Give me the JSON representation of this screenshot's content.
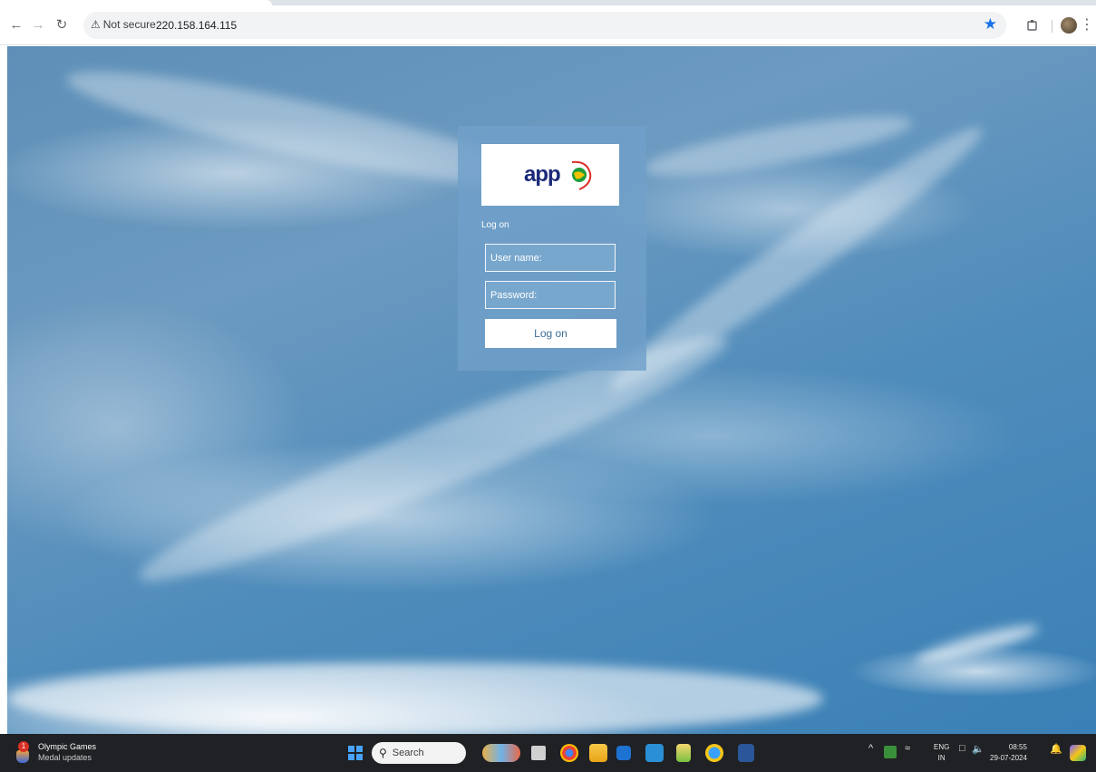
{
  "browser": {
    "security_label": "Not secure",
    "url": "220.158.164.115"
  },
  "login": {
    "logo_text": "app",
    "heading": "Log on",
    "username_placeholder": "User name:",
    "password_placeholder": "Password:",
    "submit_label": "Log on"
  },
  "taskbar": {
    "weather_badge": "1",
    "weather_title": "Olympic Games",
    "weather_subtitle": "Medal updates",
    "search_label": "Search",
    "language_line1": "ENG",
    "language_line2": "IN",
    "time": "08:55",
    "date": "29-07-2024"
  },
  "colors": {
    "panel": "#70a0c9",
    "button_text": "#3c6b97",
    "taskbar": "#1f2125",
    "bookmark_star": "#1a73e8"
  },
  "icons": {
    "back": "arrow-left-icon",
    "forward": "arrow-right-icon",
    "reload": "reload-icon",
    "security": "warning-triangle-icon",
    "bookmark": "star-icon",
    "extensions": "puzzle-icon",
    "menu": "kebab-menu-icon"
  }
}
